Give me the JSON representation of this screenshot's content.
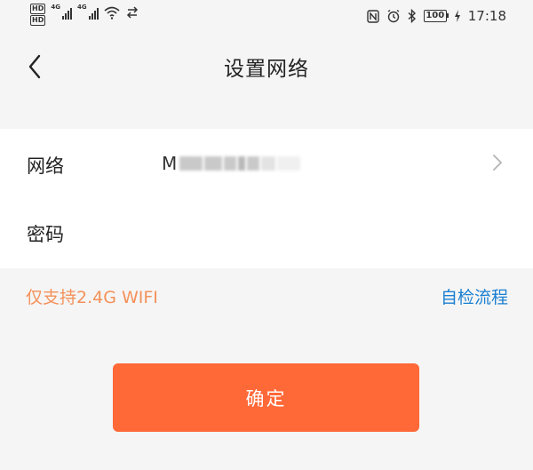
{
  "status_bar": {
    "hd_top": "HD",
    "hd_bottom": "HD",
    "sim1_tech": "4G",
    "sim2_tech": "4G",
    "battery_level": "100",
    "time": "17:18",
    "icons": [
      "hd-icon",
      "signal-icon",
      "wifi-icon",
      "nfc-icon",
      "alarm-icon",
      "bluetooth-icon",
      "battery-icon",
      "charging-icon"
    ]
  },
  "nav": {
    "back_icon": "chevron-left-icon",
    "title": "设置网络"
  },
  "form": {
    "network_label": "网络",
    "network_value_visible": "M",
    "network_chevron_icon": "chevron-right-icon",
    "password_label": "密码",
    "password_value": ""
  },
  "hint_text": "仅支持2.4G WIFI",
  "selfcheck_link": "自检流程",
  "confirm_label": "确定",
  "colors": {
    "background": "#f5f5f5",
    "hint": "#f4915a",
    "link": "#1a7fd1",
    "button": "#ff6837"
  }
}
